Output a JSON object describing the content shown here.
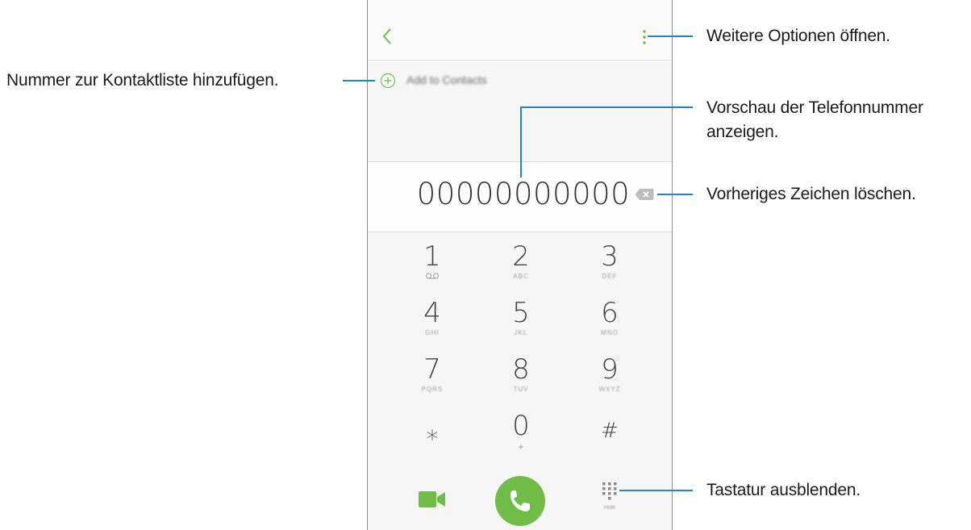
{
  "phone": {
    "add_to_contacts_label": "Add to Contacts",
    "number_display": "00000000000",
    "keys": [
      {
        "digit": "1",
        "letters": "",
        "sym": ""
      },
      {
        "digit": "2",
        "letters": "ABC",
        "sym": ""
      },
      {
        "digit": "3",
        "letters": "DEF",
        "sym": ""
      },
      {
        "digit": "4",
        "letters": "GHI",
        "sym": ""
      },
      {
        "digit": "5",
        "letters": "JKL",
        "sym": ""
      },
      {
        "digit": "6",
        "letters": "MNO",
        "sym": ""
      },
      {
        "digit": "7",
        "letters": "PQRS",
        "sym": ""
      },
      {
        "digit": "8",
        "letters": "TUV",
        "sym": ""
      },
      {
        "digit": "9",
        "letters": "WXYZ",
        "sym": ""
      },
      {
        "digit": "⁎",
        "letters": "",
        "sym": ""
      },
      {
        "digit": "0",
        "letters": "",
        "sym": "+"
      },
      {
        "digit": "#",
        "letters": "",
        "sym": ""
      }
    ],
    "hide_keypad_label": "Hide",
    "accent_color": "#6fbc47"
  },
  "callouts": {
    "more_options": "Weitere Optionen öffnen.",
    "add_to_contacts": "Nummer zur Kontaktliste hinzufügen.",
    "preview_line1": "Vorschau der Telefonnummer",
    "preview_line2": "anzeigen.",
    "delete_char": "Vorheriges Zeichen löschen.",
    "hide_keypad": "Tastatur ausblenden."
  },
  "callout_line_color": "#1e86c6"
}
